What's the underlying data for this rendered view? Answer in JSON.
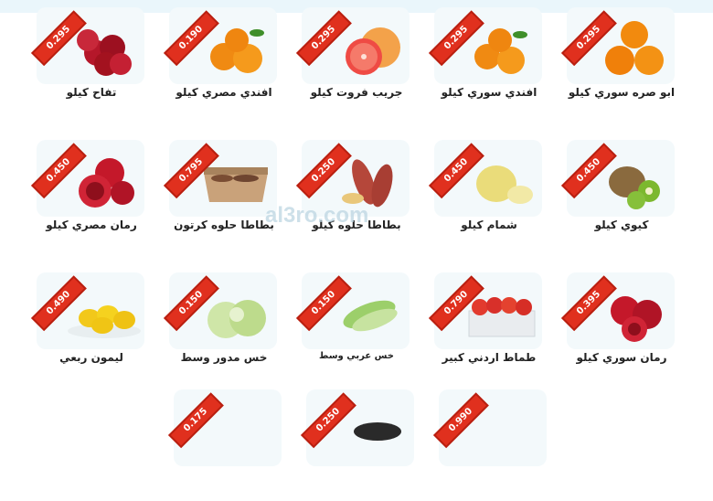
{
  "watermark": "al3ro.com",
  "products": [
    {
      "name": "تفاح كيلو",
      "price": "0.295",
      "icon": "apple-icon"
    },
    {
      "name": "افندي مصري كيلو",
      "price": "0.190",
      "icon": "tangerine-icon"
    },
    {
      "name": "جريب فروت كيلو",
      "price": "0.295",
      "icon": "grapefruit-icon"
    },
    {
      "name": "افندي سوري كيلو",
      "price": "0.295",
      "icon": "tangerine-icon"
    },
    {
      "name": "ابو صره سوري كيلو",
      "price": "0.295",
      "icon": "orange-icon"
    },
    {
      "name": "رمان مصري كيلو",
      "price": "0.450",
      "icon": "pomegranate-icon"
    },
    {
      "name": "بطاطا حلوه كرتون",
      "price": "0.795",
      "icon": "sweet-potato-box-icon"
    },
    {
      "name": "بطاطا حلوه كيلو",
      "price": "0.250",
      "icon": "sweet-potato-icon"
    },
    {
      "name": "شمام كيلو",
      "price": "0.450",
      "icon": "melon-icon"
    },
    {
      "name": "كيوي كيلو",
      "price": "0.450",
      "icon": "kiwi-icon"
    },
    {
      "name": "ليمون ربعي",
      "price": "0.490",
      "icon": "lemon-icon"
    },
    {
      "name": "خس مدور وسط",
      "price": "0.150",
      "icon": "iceberg-lettuce-icon"
    },
    {
      "name": "خس عربي وسط",
      "price": "0.150",
      "icon": "romaine-lettuce-icon"
    },
    {
      "name": "طماط اردني كبير",
      "price": "0.790",
      "icon": "tomato-box-icon"
    },
    {
      "name": "رمان سوري كيلو",
      "price": "0.395",
      "icon": "pomegranate-icon"
    },
    {
      "name": "",
      "price": "0.175",
      "icon": "item-icon"
    },
    {
      "name": "",
      "price": "0.250",
      "icon": "item-icon"
    },
    {
      "name": "",
      "price": "0.990",
      "icon": "item-icon"
    }
  ],
  "colors": {
    "ribbon": "#e0301e",
    "card": "#f3f9fb"
  }
}
